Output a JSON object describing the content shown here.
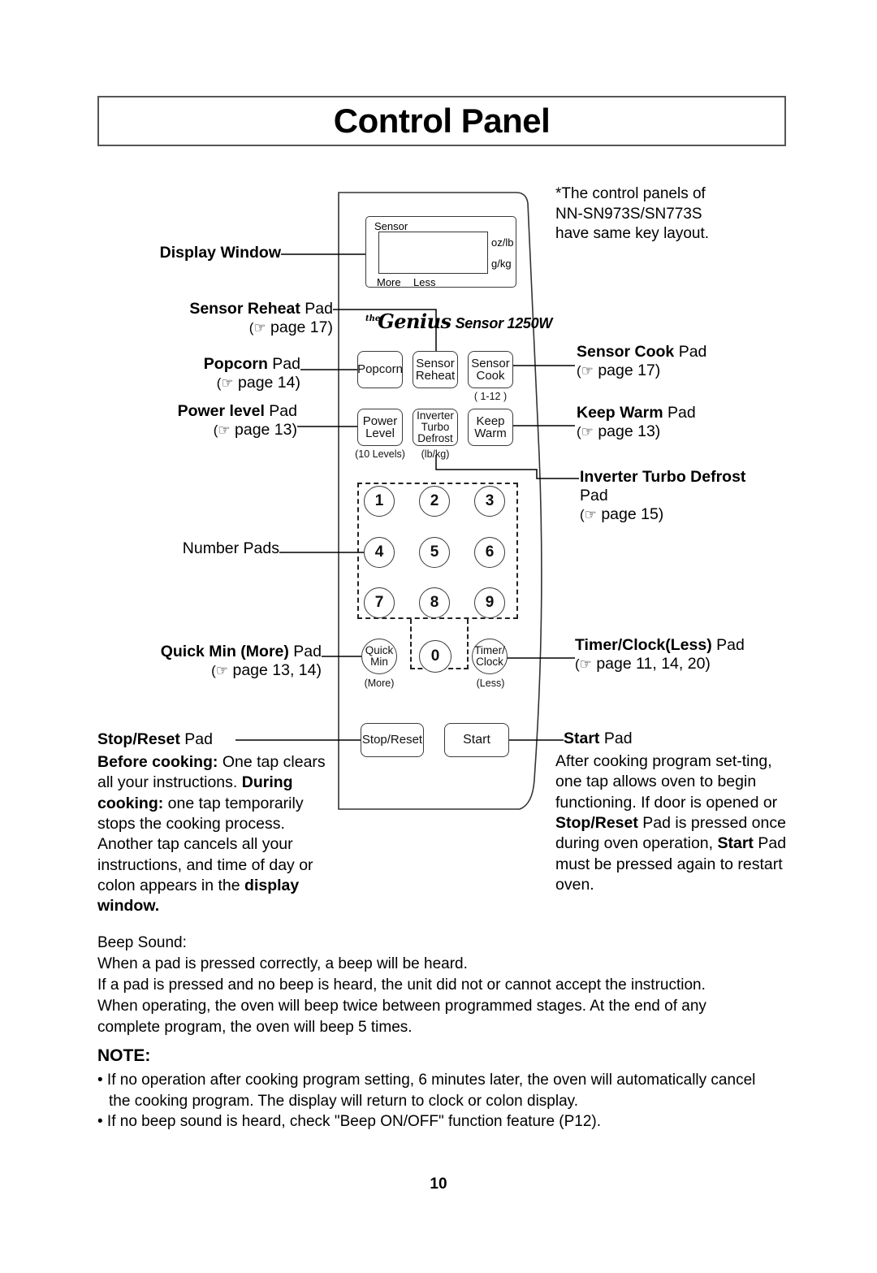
{
  "page": {
    "title": "Control Panel",
    "number": "10"
  },
  "note_star": {
    "lines": [
      "*The control panels of",
      "NN-SN973S/SN773S",
      "have same key layout."
    ]
  },
  "panel": {
    "display": {
      "sensor_label": "Sensor",
      "oz_lb": "oz/lb",
      "g_kg": "g/kg",
      "more": "More",
      "less": "Less"
    },
    "brand": {
      "the": "the",
      "genius": "Genius",
      "sensor_model": "Sensor 1250W"
    },
    "keys": [
      {
        "name": "popcorn",
        "label": "Popcorn",
        "sub": ""
      },
      {
        "name": "sensor-reheat",
        "label": "Sensor\nReheat",
        "sub": ""
      },
      {
        "name": "sensor-cook",
        "label": "Sensor\nCook",
        "sub": "( 1-12 )"
      },
      {
        "name": "power-level",
        "label": "Power\nLevel",
        "sub": "(10 Levels)"
      },
      {
        "name": "inverter-turbo-defrost",
        "label": "Inverter\nTurbo\nDefrost",
        "sub": "(lb/kg)"
      },
      {
        "name": "keep-warm",
        "label": "Keep\nWarm",
        "sub": ""
      }
    ],
    "key_labels": {
      "popcorn": "Popcorn",
      "sensor_reheat_l1": "Sensor",
      "sensor_reheat_l2": "Reheat",
      "sensor_cook_l1": "Sensor",
      "sensor_cook_l2": "Cook",
      "sensor_cook_sub": "( 1-12 )",
      "power_level_l1": "Power",
      "power_level_l2": "Level",
      "power_level_sub": "(10 Levels)",
      "inverter_l1": "Inverter",
      "inverter_l2": "Turbo",
      "inverter_l3": "Defrost",
      "inverter_sub": "(lb/kg)",
      "keep_warm_l1": "Keep",
      "keep_warm_l2": "Warm",
      "quick_min_l1": "Quick",
      "quick_min_l2": "Min",
      "quick_min_sub": "(More)",
      "timer_clock_l1": "Timer/",
      "timer_clock_l2": "Clock",
      "timer_clock_sub": "(Less)",
      "stop_reset": "Stop/Reset",
      "start": "Start",
      "zero": "0"
    },
    "number_pads": [
      "1",
      "2",
      "3",
      "4",
      "5",
      "6",
      "7",
      "8",
      "9"
    ]
  },
  "callouts": {
    "display_window": {
      "bold": "Display Window",
      "rest": ""
    },
    "sensor_reheat": {
      "bold": "Sensor Reheat",
      "rest": " Pad",
      "ref": "( page 17)"
    },
    "popcorn": {
      "bold": "Popcorn",
      "rest": " Pad",
      "ref": "( page 14)"
    },
    "power_level": {
      "bold": "Power level",
      "rest": " Pad",
      "ref": "( page 13)"
    },
    "number_pads": {
      "text": "Number Pads"
    },
    "quick_min": {
      "bold": "Quick Min (More)",
      "rest": " Pad",
      "ref": "( page 13, 14)"
    },
    "sensor_cook": {
      "bold": "Sensor Cook",
      "rest": " Pad",
      "ref": "( page 17)"
    },
    "keep_warm": {
      "bold": "Keep Warm",
      "rest": " Pad",
      "ref": "( page 13)"
    },
    "inverter_turbo_defrost": {
      "bold": "Inverter Turbo Defrost",
      "rest": "Pad",
      "ref": "( page 15)"
    },
    "timer_clock": {
      "bold": "Timer/Clock(Less)",
      "rest": " Pad",
      "ref": "( page 11, 14, 20)"
    },
    "stop_reset_title": {
      "bold": "Stop/Reset",
      "rest": " Pad"
    },
    "start_title": {
      "bold": "Start",
      "rest": " Pad"
    }
  },
  "stop_reset_body": {
    "before_label": "Before cooking:",
    "before_text": " One tap clears all your instructions.",
    "during_label": "During cooking:",
    "during_text": " one tap temporarily stops the cooking process. Another tap cancels all your instructions, and time of day or colon appears in the ",
    "display_window_bold": "display window."
  },
  "start_body": {
    "p1": "After cooking program set-ting, one tap allows oven to begin functioning. If door is opened or ",
    "stop_reset_bold": "Stop/Reset",
    "p2": " Pad is pressed once during oven operation, ",
    "start_bold": "Start",
    "p3": " Pad must be pressed again to restart oven."
  },
  "beep": {
    "heading": "Beep Sound:",
    "line1": "When a pad is pressed correctly, a beep will be heard.",
    "line2": "If a pad is pressed and no beep is heard, the unit did not or cannot accept the instruction.",
    "line3": "When operating, the oven will beep twice between programmed stages. At the end of any",
    "line4": "complete program, the oven will beep 5 times."
  },
  "note": {
    "heading": "NOTE:",
    "bullet1_line1": "• If no operation after cooking program setting, 6 minutes later, the oven will automatically cancel",
    "bullet1_line2": "the cooking program. The display will return to clock or colon display.",
    "bullet2": "• If no beep sound is heard, check \"Beep ON/OFF\" function feature (P12)."
  }
}
